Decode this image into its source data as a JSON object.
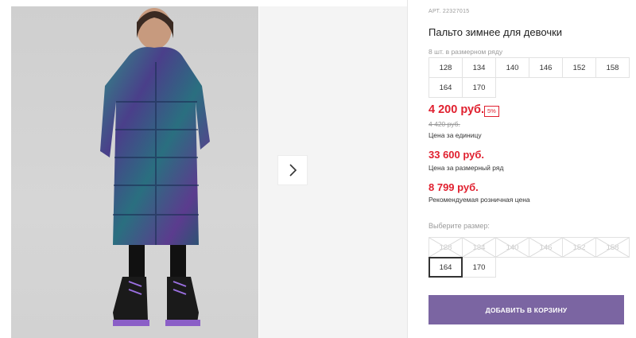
{
  "product": {
    "article_label": "АРТ.",
    "article": "22327015",
    "title": "Пальто зимнее для девочки",
    "size_count": "8 шт. в размерном ряду",
    "size_range": [
      "128",
      "134",
      "140",
      "146",
      "152",
      "158",
      "164",
      "170"
    ]
  },
  "pricing": {
    "price": "4 200 руб.",
    "discount": "5%",
    "old_price": "4 420 руб.",
    "unit_label": "Цена за единицу",
    "range_price": "33 600 руб.",
    "range_label": "Цена за размерный ряд",
    "retail_price": "8 799 руб.",
    "retail_label": "Рекомендуемая розничная цена"
  },
  "size_picker": {
    "label": "Выберите размер:",
    "sizes": [
      {
        "value": "128",
        "available": false
      },
      {
        "value": "134",
        "available": false
      },
      {
        "value": "140",
        "available": false
      },
      {
        "value": "146",
        "available": false
      },
      {
        "value": "152",
        "available": false
      },
      {
        "value": "158",
        "available": false
      },
      {
        "value": "164",
        "available": true,
        "selected": true
      },
      {
        "value": "170",
        "available": true
      }
    ]
  },
  "actions": {
    "add_to_cart": "ДОБАВИТЬ В КОРЗИНУ"
  },
  "gallery": {
    "next_icon": "chevron-right-icon"
  },
  "colors": {
    "price_red": "#e0202f",
    "button_purple": "#7b65a2"
  }
}
